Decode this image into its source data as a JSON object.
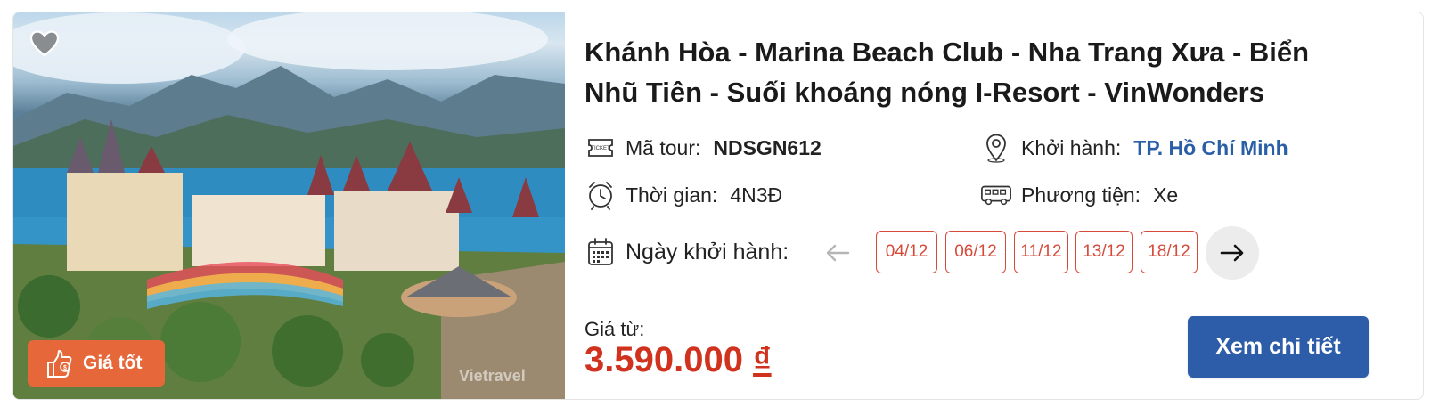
{
  "tour": {
    "title": "Khánh Hòa - Marina Beach Club - Nha Trang Xưa - Biển Nhũ Tiên - Suối khoáng nóng I-Resort - VinWonders",
    "badge_label": "Giá tốt",
    "watermark": "Vietravel",
    "code_label": "Mã tour:",
    "code_value": "NDSGN612",
    "departure_label": "Khởi hành:",
    "departure_value": "TP. Hồ Chí Minh",
    "duration_label": "Thời gian:",
    "duration_value": "4N3Đ",
    "transport_label": "Phương tiện:",
    "transport_value": "Xe",
    "dates_label": "Ngày khởi hành:",
    "dates": [
      "04/12",
      "06/12",
      "11/12",
      "13/12",
      "18/12"
    ],
    "price_label": "Giá từ:",
    "price_value": "3.590.000",
    "price_currency": "₫",
    "cta_label": "Xem chi tiết"
  },
  "colors": {
    "accent": "#2d5ca8",
    "price": "#d0321d",
    "badge": "#e5673a",
    "chip_border": "#d64a3a",
    "link": "#2a5fa6"
  },
  "icons": [
    "heart-icon",
    "thumbs-up-dollar-icon",
    "ticket-icon",
    "map-pin-icon",
    "alarm-clock-icon",
    "bus-icon",
    "calendar-icon",
    "arrow-left-icon",
    "arrow-right-icon"
  ]
}
